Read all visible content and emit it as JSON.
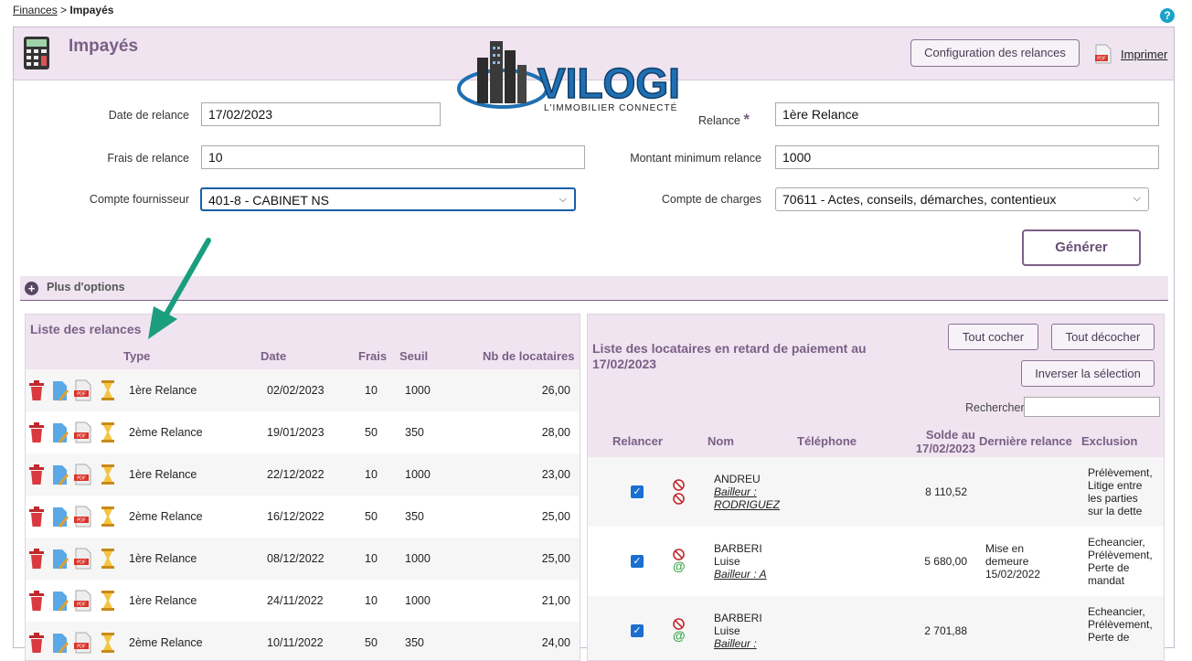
{
  "breadcrumb": {
    "parent": "Finances",
    "separator": " > ",
    "current": "Impayés"
  },
  "help": {
    "label": "?"
  },
  "header": {
    "title": "Impayés",
    "config_button": "Configuration des relances",
    "print_label": "Imprimer"
  },
  "logo": {
    "brand": "VILOGI",
    "tagline": "L'IMMOBILIER CONNECTÉ"
  },
  "form": {
    "date_relance_label": "Date de relance",
    "date_relance_value": "17/02/2023",
    "frais_label": "Frais de relance",
    "frais_value": "10",
    "fournisseur_label": "Compte fournisseur",
    "fournisseur_value": "401-8 - CABINET NS",
    "relance_label": "Relance",
    "relance_required": "*",
    "relance_value": "1ère Relance",
    "montant_label": "Montant minimum relance",
    "montant_value": "1000",
    "charges_label": "Compte de charges",
    "charges_value": "70611 - Actes, conseils, démarches, contentieux",
    "generate_button": "Générer"
  },
  "more_options": {
    "label": "Plus d'options"
  },
  "relances": {
    "title": "Liste des relances",
    "columns": [
      "Type",
      "Date",
      "Frais",
      "Seuil",
      "Nb de locataires"
    ],
    "rows": [
      {
        "type": "1ère Relance",
        "date": "02/02/2023",
        "frais": "10",
        "seuil": "1000",
        "nb": "26,00"
      },
      {
        "type": "2ème Relance",
        "date": "19/01/2023",
        "frais": "50",
        "seuil": "350",
        "nb": "28,00"
      },
      {
        "type": "1ère Relance",
        "date": "22/12/2022",
        "frais": "10",
        "seuil": "1000",
        "nb": "23,00"
      },
      {
        "type": "2ème Relance",
        "date": "16/12/2022",
        "frais": "50",
        "seuil": "350",
        "nb": "25,00"
      },
      {
        "type": "1ère Relance",
        "date": "08/12/2022",
        "frais": "10",
        "seuil": "1000",
        "nb": "25,00"
      },
      {
        "type": "1ère Relance",
        "date": "24/11/2022",
        "frais": "10",
        "seuil": "1000",
        "nb": "21,00"
      },
      {
        "type": "2ème Relance",
        "date": "10/11/2022",
        "frais": "50",
        "seuil": "350",
        "nb": "24,00"
      }
    ]
  },
  "locataires": {
    "title": "Liste des locataires en retard de paiement au 17/02/2023",
    "check_all": "Tout cocher",
    "uncheck_all": "Tout décocher",
    "invert": "Inverser la sélection",
    "search_label": "Rechercher",
    "search_value": "",
    "columns": {
      "relancer": "Relancer",
      "nom": "Nom",
      "telephone": "Téléphone",
      "solde_line1": "Solde au",
      "solde_line2": "17/02/2023",
      "derniere": "Dernière relance",
      "exclusion": "Exclusion"
    },
    "rows": [
      {
        "nom1": "ANDREU",
        "nom2": "",
        "bailleur1": "Bailleur :",
        "bailleur2": "RODRIGUEZ",
        "solde": "8 110,52",
        "derniere1": "",
        "derniere2": "",
        "derniere3": "",
        "excl1": "Prélèvement,",
        "excl2": "Litige entre",
        "excl3": "les parties",
        "excl4": "sur la dette"
      },
      {
        "nom1": "BARBERI",
        "nom2": "Luise",
        "bailleur1": "Bailleur : A",
        "bailleur2": "",
        "solde": "5 680,00",
        "derniere1": "Mise en",
        "derniere2": "demeure",
        "derniere3": "15/02/2022",
        "excl1": "Echeancier,",
        "excl2": "Prélèvement,",
        "excl3": "Perte de",
        "excl4": "mandat"
      },
      {
        "nom1": "BARBERI",
        "nom2": "Luise",
        "bailleur1": "Bailleur :",
        "bailleur2": "",
        "solde": "2 701,88",
        "derniere1": "",
        "derniere2": "",
        "derniere3": "",
        "excl1": "Echeancier,",
        "excl2": "Prélèvement,",
        "excl3": "Perte de",
        "excl4": ""
      }
    ]
  },
  "colors": {
    "accent": "#7a5f86",
    "header_bg": "#efe4f0",
    "checkbox": "#1a6fd0",
    "annotation_arrow": "#1a9e7e",
    "logo_blue": "#1f6fb2"
  }
}
